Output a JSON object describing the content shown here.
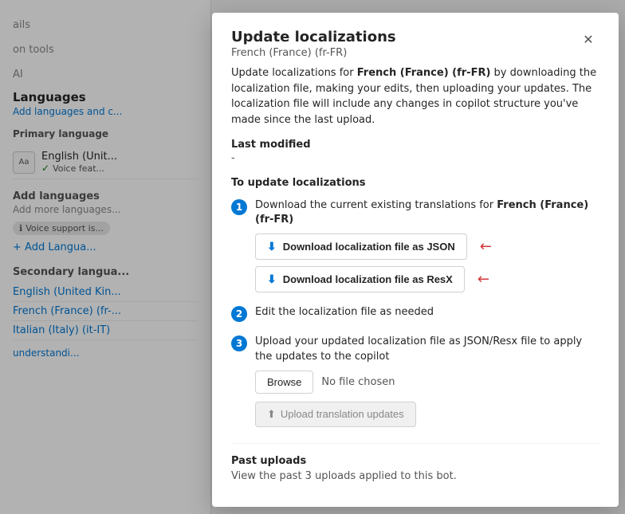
{
  "background": {
    "nav_items": [
      {
        "label": "ails",
        "faded": false
      },
      {
        "label": "on tools",
        "faded": false
      },
      {
        "label": "AI",
        "faded": false
      }
    ],
    "languages_section": {
      "title": "Languages",
      "subtitle": "Add languages and c...",
      "primary_label": "Primary language",
      "primary_lang": {
        "name": "English (Unit...",
        "sub": "Voice feat..."
      },
      "add_section": {
        "title": "Add languages",
        "subtitle": "Add more languages...",
        "voice_badge": "Voice support is...",
        "add_btn": "+ Add Langua..."
      },
      "secondary_label": "Secondary langua...",
      "secondary_langs": [
        {
          "label": "English (United Kin..."
        },
        {
          "label": "French (France) (fr-..."
        },
        {
          "label": "Italian (Italy) (it-IT)"
        }
      ],
      "understandl": "understandi..."
    }
  },
  "modal": {
    "title": "Update localizations",
    "subtitle": "French (France) (fr-FR)",
    "close_label": "✕",
    "intro": "Update localizations for ",
    "intro_bold": "French (France) (fr-FR)",
    "intro_rest": " by downloading the localization file, making your edits, then uploading your updates. The localization file will include any changes in copilot structure you've made since the last upload.",
    "last_modified_label": "Last modified",
    "last_modified_value": "-",
    "to_update_label": "To update localizations",
    "steps": [
      {
        "number": "1",
        "text": "Download the current existing translations for ",
        "text_bold": "French (France) (fr-FR)",
        "buttons": [
          {
            "label": "Download localization file as JSON",
            "name": "download-json-btn"
          },
          {
            "label": "Download localization file as ResX",
            "name": "download-resx-btn"
          }
        ]
      },
      {
        "number": "2",
        "text": "Edit the localization file as needed",
        "text_bold": ""
      },
      {
        "number": "3",
        "text": "Upload your updated localization file as JSON/Resx file to apply the updates to the copilot",
        "text_bold": ""
      }
    ],
    "browse_label": "Browse",
    "no_file_label": "No file chosen",
    "upload_label": "Upload translation updates",
    "past_uploads_label": "Past uploads",
    "past_uploads_text": "View the past 3 uploads applied to this bot."
  }
}
